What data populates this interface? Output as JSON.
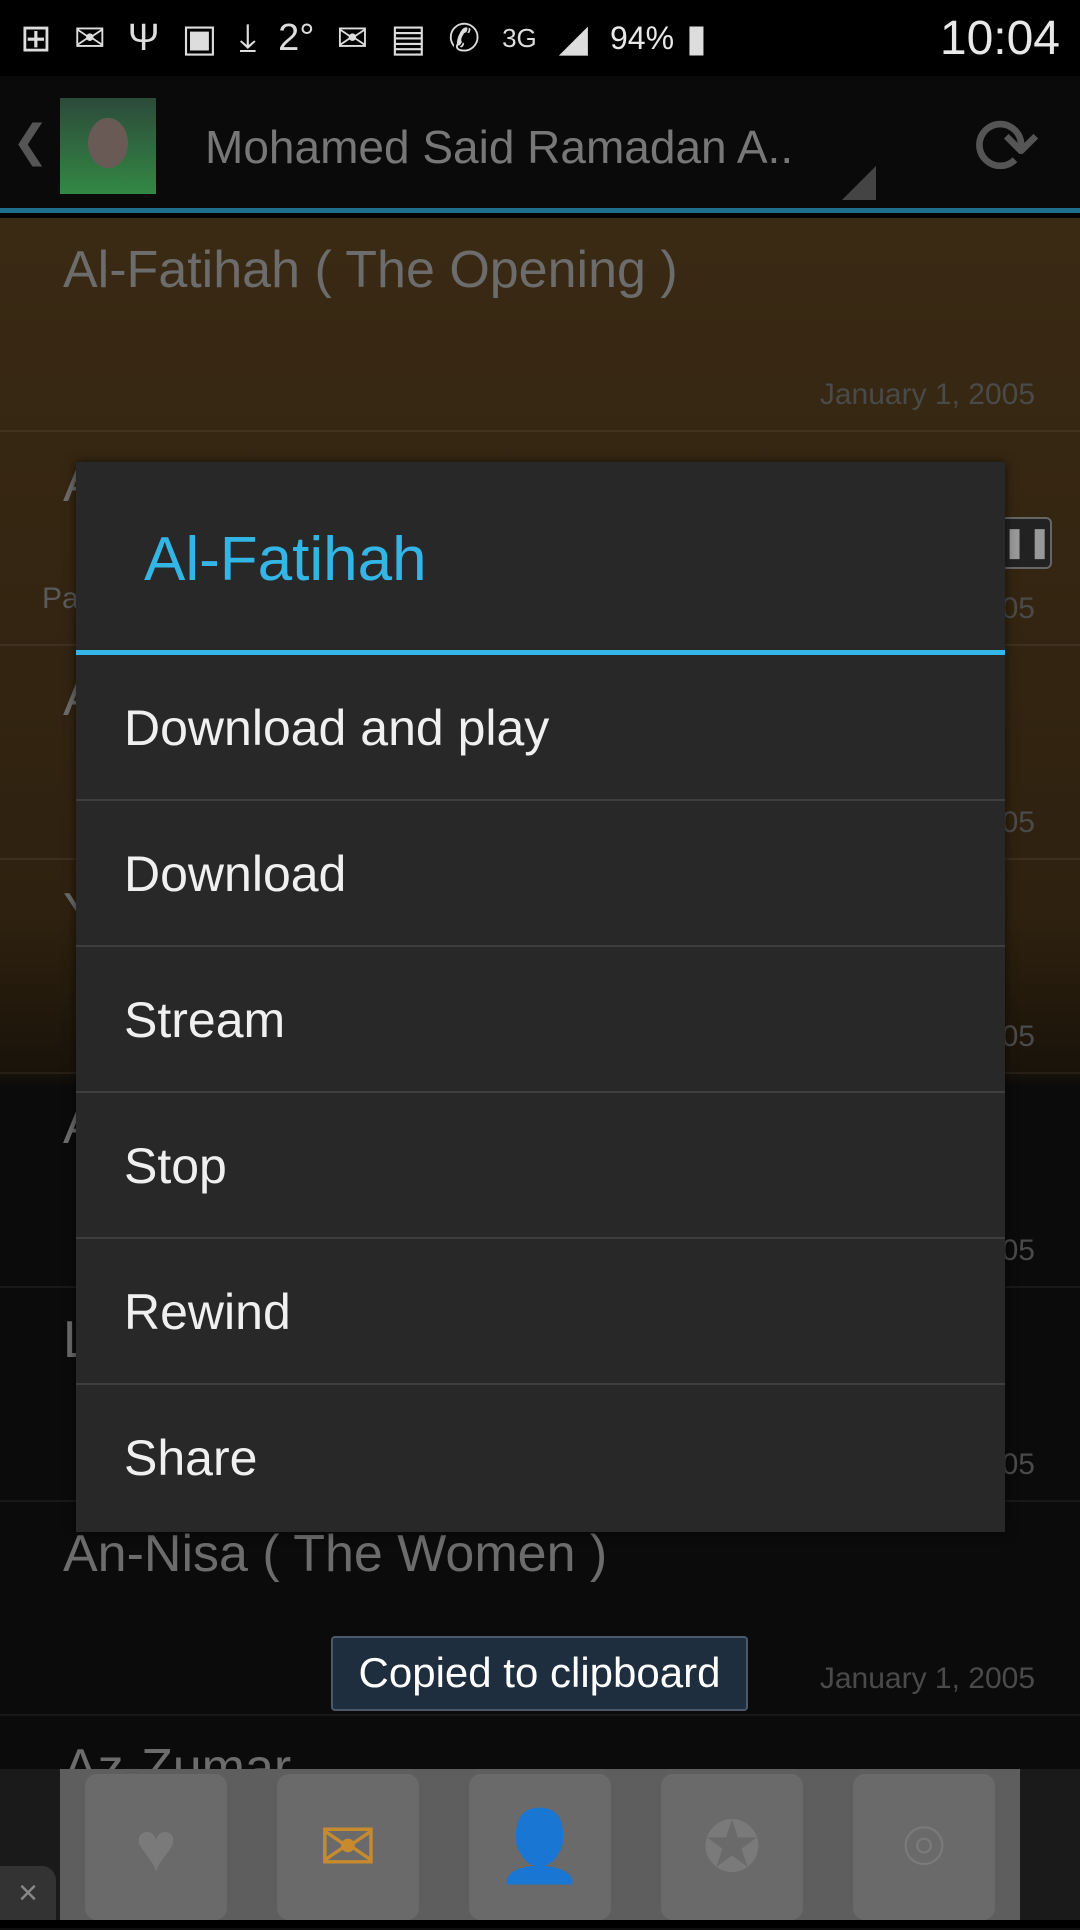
{
  "status_bar": {
    "icons": [
      "plus-badge-icon",
      "mail-icon",
      "usb-icon",
      "image-icon",
      "download-icon",
      "email-at-icon",
      "quiz-icon",
      "whatsapp-icon",
      "3g-icon",
      "signal-icon",
      "battery-charging-icon"
    ],
    "temperature": "2°",
    "network": "3G",
    "battery": "94%",
    "time": "10:04"
  },
  "action_bar": {
    "title": "Mohamed Said Ramadan A..",
    "refresh_icon": "refresh-icon"
  },
  "list": [
    {
      "title": "Al-Fatihah ( The Opening )",
      "subtitle": "",
      "date": "January 1, 2005"
    },
    {
      "title": "A",
      "subtitle": "Pa",
      "date": "05"
    },
    {
      "title": "A",
      "subtitle": "",
      "date": "05"
    },
    {
      "title": "Y",
      "subtitle": "",
      "date": "05"
    },
    {
      "title": "A",
      "subtitle": "",
      "date": "05"
    },
    {
      "title": "L",
      "subtitle": "",
      "date": "05"
    },
    {
      "title": "An-Nisa ( The Women )",
      "subtitle": "",
      "date": "January 1, 2005"
    },
    {
      "title": "Az-Zumar",
      "subtitle": "",
      "date": ""
    }
  ],
  "dialog": {
    "title": "Al-Fatihah",
    "items": [
      "Download and play",
      "Download",
      "Stream",
      "Stop",
      "Rewind",
      "Share"
    ]
  },
  "toast": "Copied to clipboard",
  "ad": {
    "close": "×"
  },
  "colors": {
    "accent": "#33b5e5",
    "dialog_bg": "#282828"
  }
}
